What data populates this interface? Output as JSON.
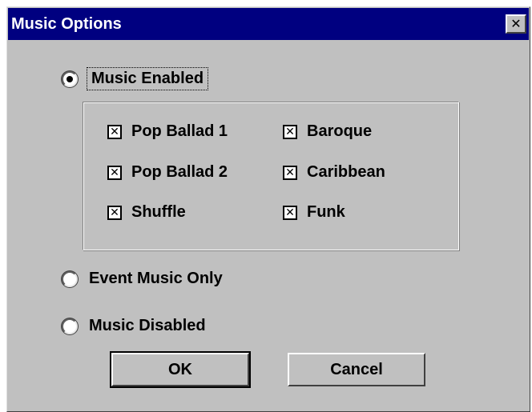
{
  "window": {
    "title": "Music Options",
    "close_symbol": "✕"
  },
  "options": {
    "music_enabled": {
      "label": "Music Enabled",
      "selected": true
    },
    "event_music_only": {
      "label": "Event Music Only",
      "selected": false
    },
    "music_disabled": {
      "label": "Music Disabled",
      "selected": false
    }
  },
  "styles": [
    {
      "label": "Pop Ballad 1",
      "checked": true,
      "mark": "✕"
    },
    {
      "label": "Baroque",
      "checked": true,
      "mark": "✕"
    },
    {
      "label": "Pop Ballad 2",
      "checked": true,
      "mark": "✕"
    },
    {
      "label": "Caribbean",
      "checked": true,
      "mark": "✕"
    },
    {
      "label": "Shuffle",
      "checked": true,
      "mark": "✕"
    },
    {
      "label": "Funk",
      "checked": true,
      "mark": "✕"
    }
  ],
  "buttons": {
    "ok_label": "OK",
    "cancel_label": "Cancel"
  },
  "colors": {
    "title_bar": "#000080",
    "dialog_face": "#c0c0c0"
  }
}
